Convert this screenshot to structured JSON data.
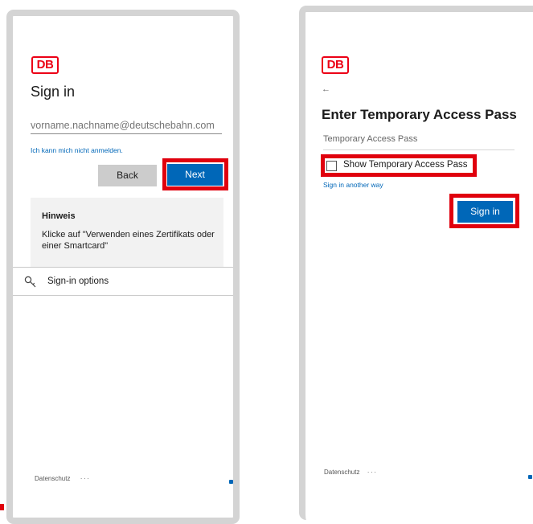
{
  "brand": {
    "logo_text": "DB",
    "accent": "#ec0016",
    "highlight": "#e0000d",
    "button_blue": "#0067b8"
  },
  "left": {
    "title": "Sign in",
    "email": {
      "placeholder": "vorname.nachname@deutschebahn.com",
      "value": ""
    },
    "cant_sign_in_link": "Ich kann mich nicht anmelden.",
    "back_label": "Back",
    "next_label": "Next",
    "note_title": "Hinweis",
    "note_text": "Klicke auf \"Verwenden eines Zertifikats oder einer Smartcard\"",
    "signin_options_label": "Sign-in options",
    "footer_privacy": "Datenschutz",
    "footer_more": "..."
  },
  "right": {
    "back_arrow": "←",
    "title": "Enter Temporary Access Pass",
    "tap_label": "Temporary Access Pass",
    "show_tap_label": "Show Temporary Access Pass",
    "show_tap_checked": false,
    "another_way_link": "Sign in another way",
    "signin_label": "Sign in",
    "footer_privacy": "Datenschutz",
    "footer_more": "..."
  }
}
